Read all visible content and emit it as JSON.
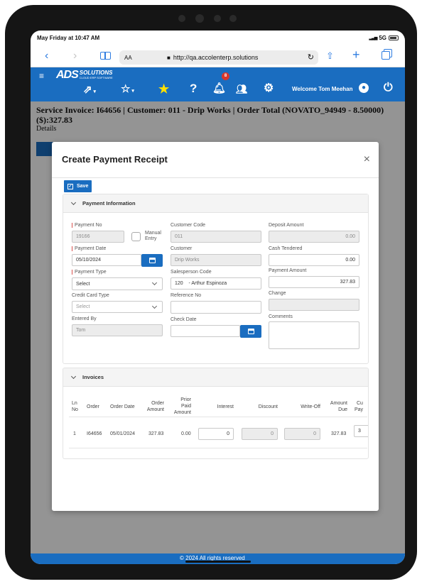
{
  "ios_status": {
    "time": "May Friday at 10:47 AM",
    "signal": "5G"
  },
  "browser": {
    "text_size": "AA",
    "url": "http://qa.accolenterp.solutions"
  },
  "appbar": {
    "logo_main": "ADS",
    "logo_sub": "SOLUTIONS",
    "logo_tag": "CLOUD ERP SOFTWARE",
    "notification_count": "8",
    "welcome": "Welcome Tom Meehan"
  },
  "page": {
    "heading": "Service Invoice: I64656 | Customer: 011 - Drip Works | Order Total (NOVATO_94949 - 8.50000) ($):327.83",
    "details": "Details"
  },
  "modal": {
    "title": "Create Payment Receipt",
    "close": "×",
    "save_label": "Save",
    "payment_section": "Payment Information",
    "fields": {
      "payment_no_label": "Payment No",
      "payment_no": "19166",
      "manual_entry_label": "Manual Entry",
      "payment_date_label": "Payment Date",
      "payment_date": "05/10/2024",
      "payment_type_label": "Payment Type",
      "payment_type": "Select",
      "credit_card_type_label": "Credit Card Type",
      "credit_card_type": "Select",
      "entered_by_label": "Entered By",
      "entered_by": "Tom",
      "customer_code_label": "Customer Code",
      "customer_code": "011",
      "customer_label": "Customer",
      "customer": "Drip Works",
      "salesperson_code_label": "Salesperson Code",
      "salesperson_code": "120    - Arthur Espinoza",
      "reference_no_label": "Reference No",
      "reference_no": "",
      "check_date_label": "Check Date",
      "check_date": "",
      "deposit_amount_label": "Deposit Amount",
      "deposit_amount": "0.00",
      "cash_tendered_label": "Cash Tendered",
      "cash_tendered": "0.00",
      "payment_amount_label": "Payment Amount",
      "payment_amount": "327.83",
      "change_label": "Change",
      "change": "",
      "comments_label": "Comments",
      "comments": ""
    },
    "invoices_section": "Invoices",
    "invoice_headers": {
      "ln1": "Ln",
      "ln2": "No",
      "order": "Order",
      "order_date": "Order Date",
      "oa1": "Order",
      "oa2": "Amount",
      "pp1": "Prior",
      "pp2": "Paid",
      "pp3": "Amount",
      "interest": "Interest",
      "discount": "Discount",
      "writeoff": "Write-Off",
      "ad1": "Amount",
      "ad2": "Due",
      "cu1": "Cu",
      "cu2": "Pay"
    },
    "invoice_row": {
      "ln": "1",
      "order": "I64656",
      "order_date": "05/01/2024",
      "order_amount": "327.83",
      "prior_paid": "0.00",
      "interest": "0",
      "discount": "0",
      "writeoff": "0",
      "amount_due": "327.83",
      "current_pay": "3"
    }
  },
  "footer": {
    "copyright": "© 2024 All rights reserved"
  }
}
